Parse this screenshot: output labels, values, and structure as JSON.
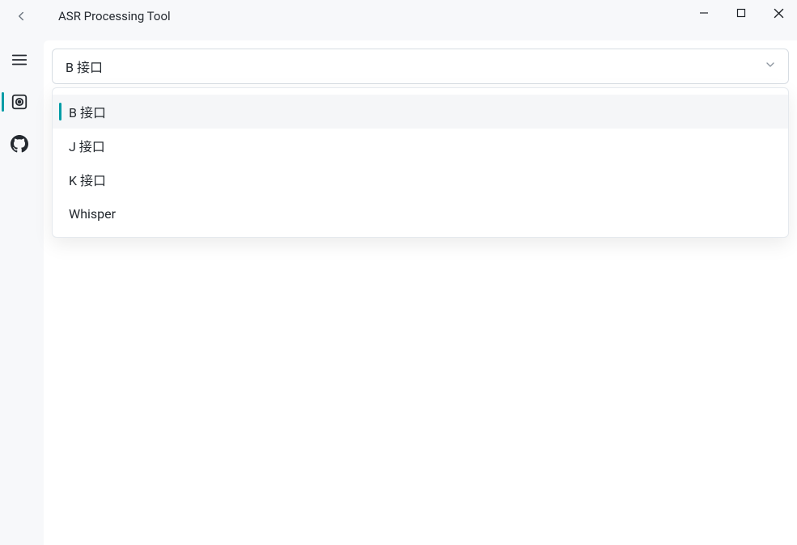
{
  "window": {
    "title": "ASR Processing Tool"
  },
  "select": {
    "value": "B 接口",
    "options": [
      {
        "label": "B 接口",
        "selected": true
      },
      {
        "label": "J 接口",
        "selected": false
      },
      {
        "label": "K 接口",
        "selected": false
      },
      {
        "label": "Whisper",
        "selected": false
      }
    ]
  }
}
